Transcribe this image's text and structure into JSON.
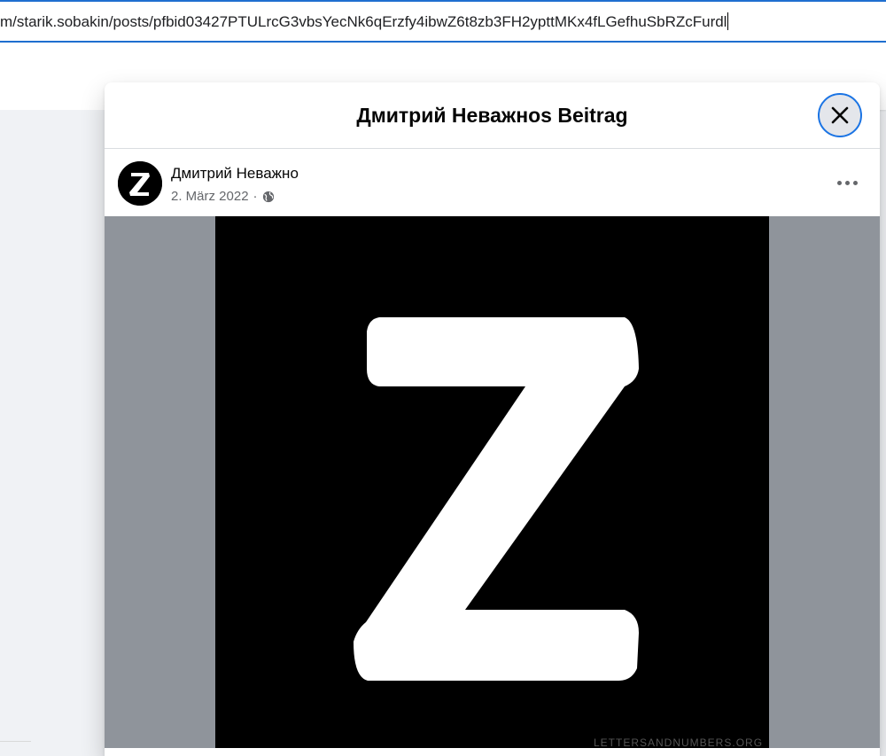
{
  "browser": {
    "url": "m/starik.sobakin/posts/pfbid03427PTULrcG3vbsYecNk6qErzfy4ibwZ6t8zb3FH2ypttMKx4fLGefhuSbRZcFurdl"
  },
  "nav": {
    "icons": [
      "home-icon",
      "video-icon",
      "marketplace-icon",
      "groups-icon",
      "gaming-icon"
    ],
    "accent": "#1b74e4"
  },
  "modal": {
    "title": "Дмитрий Неважноs Beitrag",
    "close_icon": "close-icon"
  },
  "post": {
    "author": "Дмитрий Неважно",
    "date": "2. März 2022",
    "separator": "·",
    "audience_icon": "globe-icon",
    "more_icon": "more-options-icon",
    "avatar_letter": "Z",
    "image_letter": "Z",
    "watermark": "LETTERSANDNUMBERS.ORG"
  }
}
